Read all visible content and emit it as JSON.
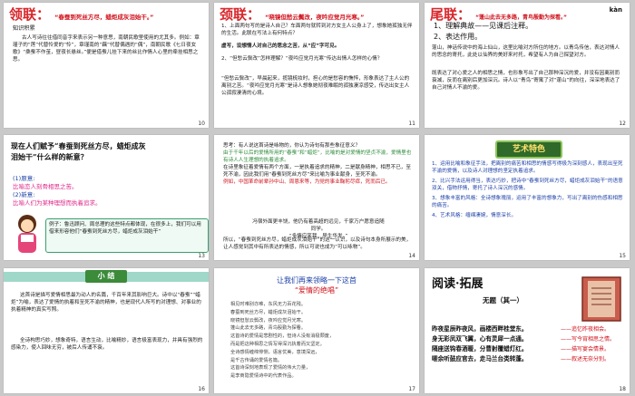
{
  "slides": [
    {
      "number": "10",
      "heading": "领联：",
      "verse": "“春蚕到死丝方尽，蜡炬成灰泪始干。”",
      "section_title": "知识积累",
      "body": "古人写诗往往借同音字来表示另一种意思，南朝民歌里使用的尤其多。例如：章瑾子的“莲”代替怜爱的“怜”，章瑾南的“藕”代替偶遇的“偶”，南朝民歌《七日夜女歌》“桑蚕不作茧，昼夜长悬丝。”便是借蚕儿挂下来的丝比作情人心里的牵挂相思之思。"
    },
    {
      "number": "11",
      "heading": "颈联：",
      "verse": "“晓镜但愁云鬓改，夜吟应觉月光寒。”",
      "q1": "1、上面两句写的是诗人自己？车面两句就转到对方女主人公身上了，想象她孤独无伴的生活。此联在写法上有何特点？",
      "a1": "虚写，设想情人对自己的思念之苦，从“应”字可见。",
      "q2": "2、“但愁云鬓改”怎样理解？“夜吟应觉月光寒”传达出情人怎样的心情？",
      "a2": "“但愁云鬓改”，早晨起来，揽镜梳妆时，担心的是愁容的憔悴，形象表达了主人公的离别之苦。“夜吟应觉月光寒”是诗人想象她彻夜难眠的孤独凄凉感受，传达出女主人公孤寂凄清的心境。"
    },
    {
      "number": "12",
      "heading": "尾联：",
      "verse": "“蓬山此去无多路，青鸟殷勤为探看。”",
      "extra": "kàn",
      "items": [
        "1、理解典故——见课后注释。",
        "2、表达作用。"
      ],
      "body": "蓬山，神话传说中的海上仙山，这里比喻对方所住的地方。以青鸟传信，表达对情人的思念的寄托，此处以仙界的美好来衬托，希望有人为自己探望对方。",
      "body2": "既表达了对心爱之人的相思之情，也形象写出了自己那种深沉的爱，并没有因离别而衰减，反而在离别后更加深沉。诗人以“青鸟”寄寓了对“蓬山”的向往，深深地表达了自己对情人不渝的爱。"
    },
    {
      "number": "13",
      "question": "现在人们赋予“春蚕到死丝方尽，蜡炬成灰泪始干”什么样的新意？",
      "orig_label": "(1)原意:",
      "orig_text": "比喻恋人刻骨相思之苦。",
      "new_label": "(2)新意:",
      "new_text": "比喻人们为某种理想而执着追求。",
      "example": "例子：鲁迅顾问、周总理的这些特点都体现，在很多上，我们可以用借来形容他们“春蚕到死丝方尽，蜡炬成灰泪始干”"
    },
    {
      "number": "14",
      "lines": [
        "思考：有人说这首诗是咏物的，你认为诗句有那些象征意义？",
        "由于千年以后的爱情所用的“春蚕”和“蜡炬”，比喻的是对爱情的坚贞不渝，爱情里也有诗人人生理想的执着追求。",
        "在诗里象征着爱情有两个方面，一是执着追求的精神，二是献身精神，相思不已，至死不渝，因此我们用“春蚕到死丝方尽”来比喻为事业献身，至死不渝。",
        "例如，中国革命前辈孙中山、周恩来等，为党的事业鞠躬尽瘁，死而后已。"
      ],
      "poem_a": "冯宿外面更丰饶，他仍有着高超的远见，千家万户愿意追随同学。",
      "poem_b": "“多情应笑我，早生华发。”",
      "footer": "所以，“春蚕到死丝方尽，蜡炬成灰泪始干”的这一认识，以及诗句本身所展示的美，让人感觉到其中有所表达的情感，所以可说也成为“可以咏物”。"
    },
    {
      "number": "15",
      "title": "艺术特色",
      "points": [
        "1、运用比喻和象征手法，把离别的痛苦和相思的情感写得极为深刻感人，表现出至死不渝的爱情，以及诗人对理想的坚定执着追求。",
        "2、比兴手法运用得当，表达巧妙，把诗中“春蚕到死丝方尽，蜡炬成灰泪始干”的语意双关，借物抒情，寄托了诗人深沉的感情。",
        "3、想象丰富的风格：全诗想象瑰丽，运用了丰富的想象力，写出了离别的伤感和相思的痛苦。",
        "4、艺术风格：缠绵凄婉，情意深长。"
      ]
    },
    {
      "number": "16",
      "title": "小 结",
      "body": "这首诗是描写爱情相思最为动人的名篇，千百年来其影响巨大。诗中以“春蚕”“蜡炬”为喻，表达了爱情的执着和至死不渝的精神，也是现代人所写的对理想、对事业的执着精神的真实写照。",
      "body2": "全诗构思巧妙，想象奇特，语言生动，比喻精妙，语言极富表现力，并具有强烈的感染力，使人回味无穷，被后人传诵不衰。"
    },
    {
      "number": "17",
      "title": "让我们再来领略一下这首",
      "subtitle": "“爱情的绝唱”",
      "lines": [
        "相见时难别亦难，东风无力百花残。",
        "春蚕到死丝方尽，蜡炬成灰泪始干。",
        "晓镜但愁云鬓改，夜吟应觉月光寒。",
        "蓬山此去无多路，青鸟殷勤为探看。",
        "这首诗的爱情是悲剧性的，但诗人没有消极颓废，",
        "而是把这种相思之情写得深沉执着而又坚定。",
        "全诗感情缠绵悱恻，语言优美，意境深远，",
        "是千古传诵的爱情名篇。",
        "这首诗深刻地表现了爱情的伟大力量，",
        "是李商隐爱情诗中的代表作品。"
      ]
    },
    {
      "number": "18",
      "title": "阅读·拓展",
      "poem_title": "无题（其一）",
      "poem": [
        "昨夜星辰昨夜风，画楼西畔桂堂东。",
        "身无彩凤双飞翼，心有灵犀一点通。",
        "隔座送钩春酒暖，分曹射覆蜡灯红。",
        "嗟余听鼓应官去，走马兰台类转蓬。"
      ],
      "notes": [
        "——追忆昨夜相会。",
        "——写今宵相思之情。",
        "——描写宴会情景。",
        "——叙述无奈分别。"
      ]
    }
  ],
  "colors": {
    "accent_red": "#d0111b",
    "accent_blue": "#1b3fa6",
    "mint": "#9fd8c8"
  }
}
